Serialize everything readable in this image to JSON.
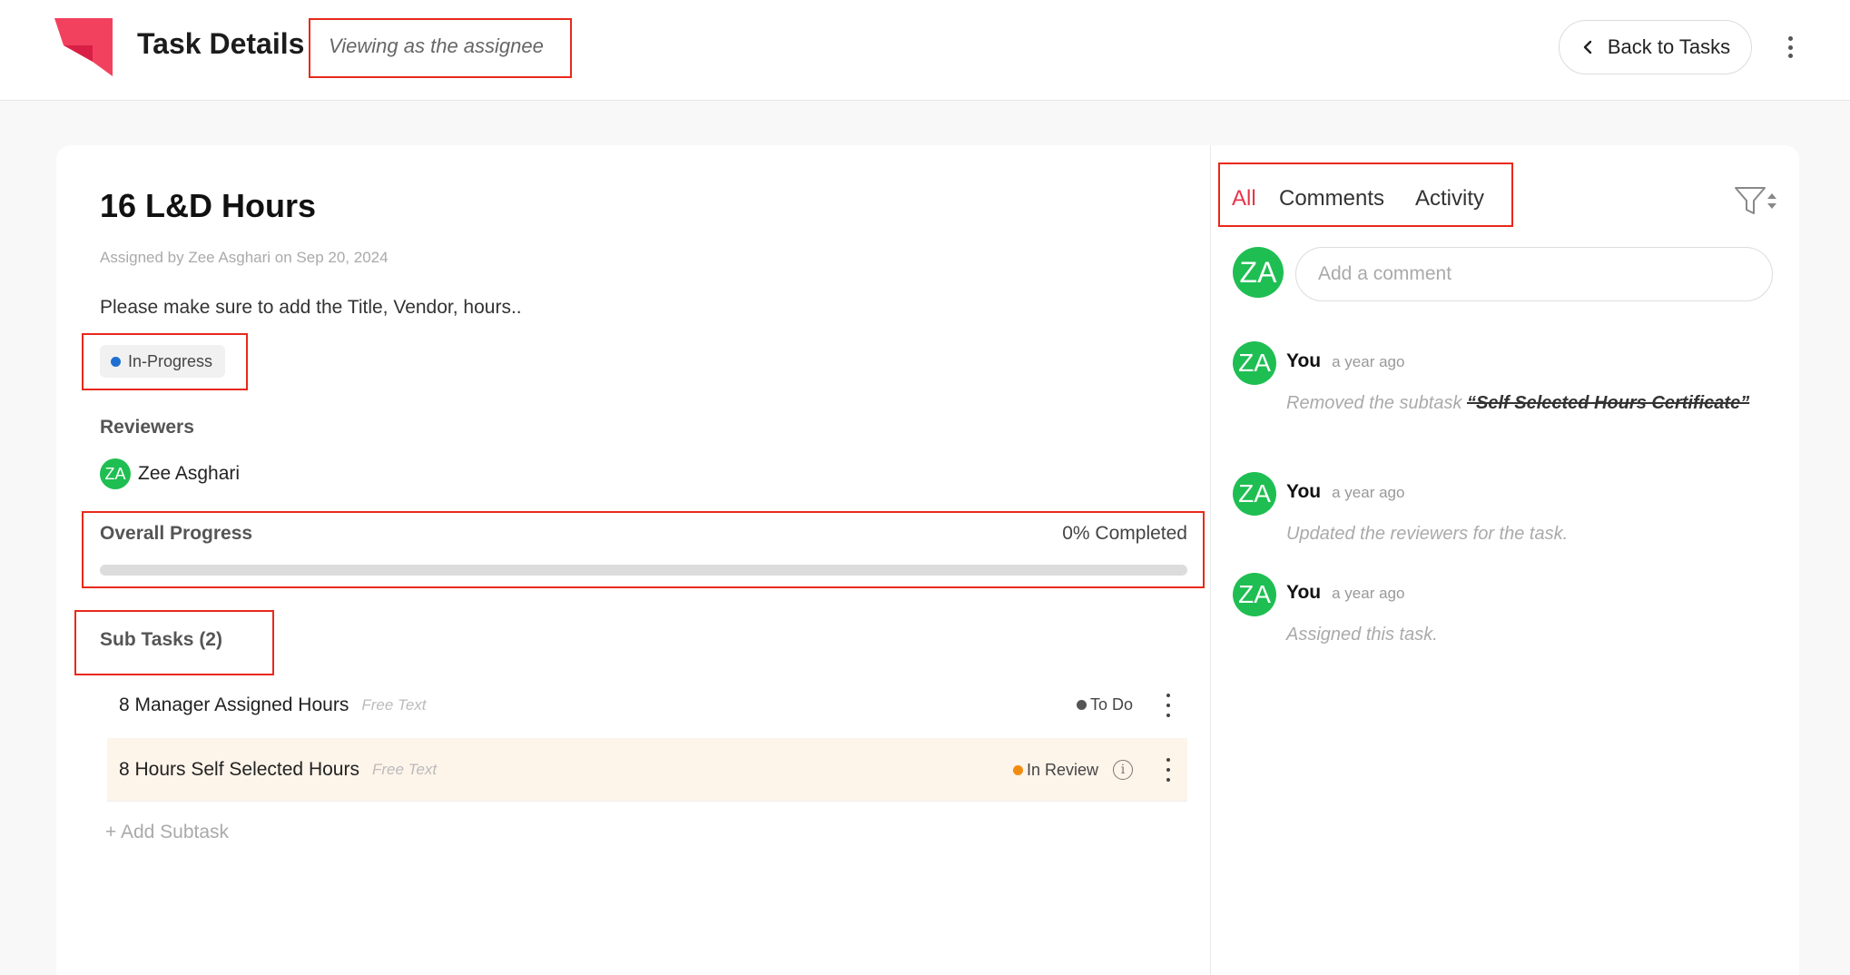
{
  "header": {
    "title": "Task Details",
    "viewing_note": "Viewing as the assignee",
    "back_label": "Back to Tasks"
  },
  "task": {
    "title": "16 L&D Hours",
    "assigned_by": "Assigned by Zee Asghari on  Sep 20, 2024",
    "description": "Please make sure to add the Title, Vendor, hours..",
    "status": "In-Progress",
    "reviewers_label": "Reviewers",
    "reviewers": [
      {
        "initials": "ZA",
        "name": "Zee Asghari"
      }
    ],
    "progress_label": "Overall Progress",
    "progress_text": "0% Completed",
    "progress_fraction": 0,
    "subtasks_label": "Sub Tasks (2)",
    "subtasks": [
      {
        "name": "8 Manager Assigned Hours",
        "type": "Free Text",
        "status": "To Do",
        "status_color": "#555555"
      },
      {
        "name": "8 Hours Self Selected Hours",
        "type": "Free Text",
        "status": "In Review",
        "status_color": "#f28c10"
      }
    ],
    "add_subtask_label": "+ Add Subtask"
  },
  "panel": {
    "tabs": [
      "All",
      "Comments",
      "Activity"
    ],
    "active_tab": "All",
    "comment_avatar": "ZA",
    "comment_placeholder": "Add a comment",
    "activity": [
      {
        "initials": "ZA",
        "who": "You",
        "when": "a year ago",
        "text_prefix": "Removed the subtask ",
        "text_strike": "“Self Selected Hours Certificate”"
      },
      {
        "initials": "ZA",
        "who": "You",
        "when": "a year ago",
        "text_prefix": "Updated the reviewers for the task.",
        "text_strike": ""
      },
      {
        "initials": "ZA",
        "who": "You",
        "when": "a year ago",
        "text_prefix": "Assigned this task.",
        "text_strike": ""
      }
    ]
  },
  "colors": {
    "brand": "#f2415e",
    "accent": "#e8334a",
    "avatar": "#1fbe52",
    "in_progress": "#1f6fd1",
    "annotation": "#e8291b"
  }
}
